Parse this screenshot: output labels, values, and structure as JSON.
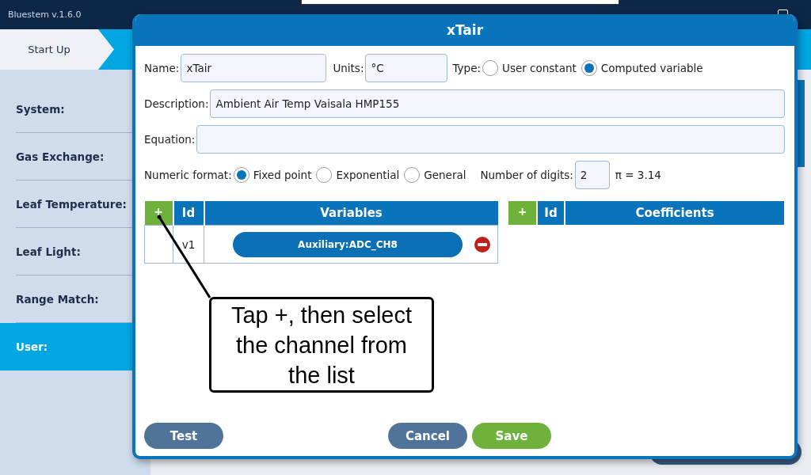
{
  "app": {
    "version": "Bluestem v.1.6.0"
  },
  "breadcrumb": [
    {
      "label": "Start Up",
      "selected": false
    }
  ],
  "sidebar": {
    "items": [
      {
        "label": "System:",
        "selected": false
      },
      {
        "label": "Gas Exchange:",
        "selected": false
      },
      {
        "label": "Leaf Temperature:",
        "selected": false
      },
      {
        "label": "Leaf Light:",
        "selected": false
      },
      {
        "label": "Range Match:",
        "selected": false
      },
      {
        "label": "User:",
        "selected": true
      }
    ]
  },
  "dialog": {
    "title": "xTair",
    "name": {
      "label": "Name:",
      "value": "xTair"
    },
    "units": {
      "label": "Units:",
      "value": "°C"
    },
    "type": {
      "label": "Type:",
      "options": [
        {
          "label": "User constant",
          "selected": false
        },
        {
          "label": "Computed variable",
          "selected": true
        }
      ]
    },
    "description": {
      "label": "Description:",
      "value": "Ambient Air Temp Vaisala HMP155"
    },
    "equation": {
      "label": "Equation:"
    },
    "numeric_format": {
      "label": "Numeric format:",
      "options": [
        {
          "label": "Fixed point",
          "selected": true
        },
        {
          "label": "Exponential",
          "selected": false
        },
        {
          "label": "General",
          "selected": false
        }
      ]
    },
    "digits": {
      "label": "Number of digits:",
      "value": "2"
    },
    "preview": "π = 3.14",
    "variables": {
      "add": "+",
      "columns": [
        "Id",
        "Variables"
      ],
      "rows": [
        {
          "id": "v1",
          "source": "Auxiliary:ADC_CH8"
        }
      ]
    },
    "coefficients": {
      "add": "+",
      "columns": [
        "Id",
        "Coefficients"
      ]
    },
    "buttons": [
      {
        "label": "Test",
        "kind": "secondary"
      },
      {
        "label": "Cancel",
        "kind": "secondary"
      },
      {
        "label": "Save",
        "kind": "primary"
      }
    ]
  },
  "callout": {
    "text": "Tap +, then select the channel from the list"
  }
}
